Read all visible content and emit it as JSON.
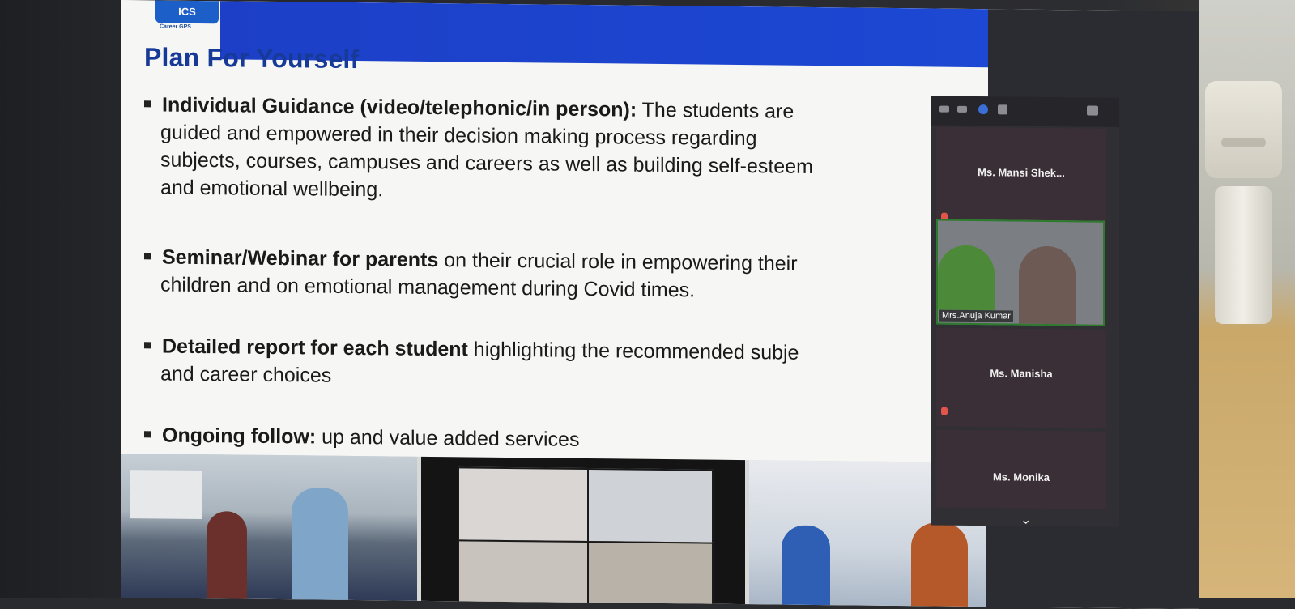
{
  "slide": {
    "logo_text": "ICS",
    "logo_subtext": "Career GPS",
    "title": "Plan For Yourself",
    "bullets": [
      {
        "bold": "Individual Guidance (video/telephonic/in person):",
        "lines": [
          " The students are",
          "guided and empowered in their decision making process regarding",
          "subjects, courses, campuses and careers as well as building self-esteem",
          "and emotional wellbeing."
        ]
      },
      {
        "bold": "Seminar/Webinar for parents",
        "lines": [
          " on their crucial role in empowering their",
          "children and on emotional management during Covid times."
        ]
      },
      {
        "bold": "Detailed report for each student",
        "lines": [
          " highlighting the recommended subje",
          "and career choices"
        ]
      },
      {
        "bold": "Ongoing follow:",
        "lines": [
          " up and value added services"
        ]
      }
    ]
  },
  "participants_panel": {
    "participants": [
      {
        "name": "Ms. Mansi Shek..."
      },
      {
        "name": "Mrs.Anuja Kumar",
        "video": true
      },
      {
        "name": "Ms. Manisha"
      },
      {
        "name": "Ms. Monika"
      }
    ],
    "icons": [
      "minimize-icon",
      "window-icon",
      "speaker-view-icon",
      "gallery-view-icon",
      "exit-fullscreen-icon",
      "chevron-down-icon"
    ]
  },
  "colors": {
    "header_blue": "#1d3fc7",
    "title_blue": "#173a98",
    "panel_bg": "#2f2f34",
    "mic_muted_red": "#e2554d"
  }
}
